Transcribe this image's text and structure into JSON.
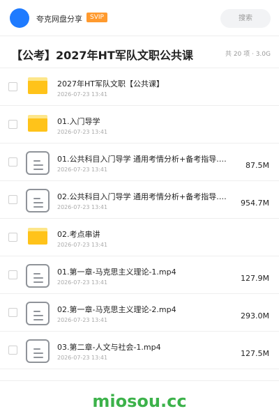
{
  "header": {
    "app_name": "夸克网盘分享",
    "badge": "SVIP",
    "search_placeholder": "搜索"
  },
  "title_bar": {
    "title": "【公考】2027年HT军队文职公共课",
    "meta": "共 20 项 · 3.0G"
  },
  "files": [
    {
      "type": "folder",
      "name": "2027年HT军队文职【公共课】",
      "date": "2026-07-23 13:41",
      "size": ""
    },
    {
      "type": "folder",
      "name": "01.入门导学",
      "date": "2026-07-23 13:41",
      "size": ""
    },
    {
      "type": "file",
      "name": "01.公共科目入门导学 通用考情分析+备考指导.mp4",
      "date": "2026-07-23 13:41",
      "size": "87.5M"
    },
    {
      "type": "file",
      "name": "02.公共科目入门导学 通用考情分析+备考指导.mp4",
      "date": "2026-07-23 13:41",
      "size": "954.7M"
    },
    {
      "type": "folder",
      "name": "02.考点串讲",
      "date": "2026-07-23 13:41",
      "size": ""
    },
    {
      "type": "file",
      "name": "01.第一章-马克思主义理论-1.mp4",
      "date": "2026-07-23 13:41",
      "size": "127.9M"
    },
    {
      "type": "file",
      "name": "02.第一章-马克思主义理论-2.mp4",
      "date": "2026-07-23 13:41",
      "size": "293.0M"
    },
    {
      "type": "file",
      "name": "03.第二章-人文与社会-1.mp4",
      "date": "2026-07-23 13:41",
      "size": "127.5M"
    }
  ],
  "watermark": "miosou.cc",
  "colors": {
    "accent": "#1f7bff",
    "badge": "#ff9a2e",
    "folder": "#ffc31a",
    "watermark": "#3cb24a"
  },
  "icons": {
    "folder": "folder-icon",
    "file": "document-icon"
  }
}
